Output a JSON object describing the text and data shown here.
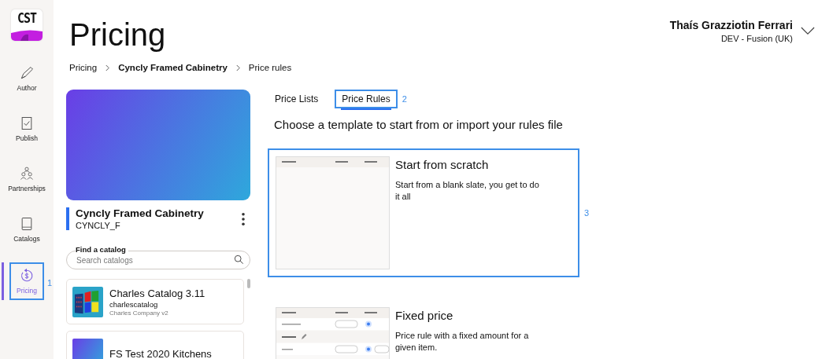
{
  "logo": {
    "text": "CST"
  },
  "nav": [
    {
      "label": "Author",
      "selected": false,
      "highlighted": false
    },
    {
      "label": "Publish",
      "selected": false,
      "highlighted": false
    },
    {
      "label": "Partnerships",
      "selected": false,
      "highlighted": false
    },
    {
      "label": "Catalogs",
      "selected": false,
      "highlighted": false
    },
    {
      "label": "Pricing",
      "selected": true,
      "highlighted": true,
      "marker": "1"
    }
  ],
  "page_title": "Pricing",
  "user": {
    "name": "Thaís Grazziotin Ferrari",
    "org": "DEV - Fusion (UK)"
  },
  "breadcrumb": [
    {
      "label": "Pricing",
      "bold": false
    },
    {
      "label": "Cyncly Framed Cabinetry",
      "bold": true
    },
    {
      "label": "Price rules",
      "bold": false
    }
  ],
  "catalog": {
    "name": "Cyncly Framed Cabinetry",
    "code": "CYNCLY_F"
  },
  "search": {
    "label": "Find a catalog",
    "placeholder": "Search catalogs"
  },
  "catalogs": [
    {
      "name": "Charles Catalog 3.11",
      "code": "charlescatalog",
      "company": "Charles Company v2"
    },
    {
      "name": "FS Test 2020 Kitchens"
    }
  ],
  "tabs": [
    {
      "label": "Price Lists",
      "selected": false,
      "highlighted": false
    },
    {
      "label": "Price Rules",
      "selected": true,
      "highlighted": true,
      "marker": "2"
    }
  ],
  "heading": "Choose a template to start from or import your rules file",
  "templates": [
    {
      "title": "Start from scratch",
      "description": "Start from a blank slate, you get to do it all",
      "highlighted": true,
      "marker": "3",
      "kind": "blank"
    },
    {
      "title": "Fixed price",
      "description": "Price rule with a fixed amount for a given item.",
      "highlighted": false,
      "kind": "filled"
    }
  ]
}
